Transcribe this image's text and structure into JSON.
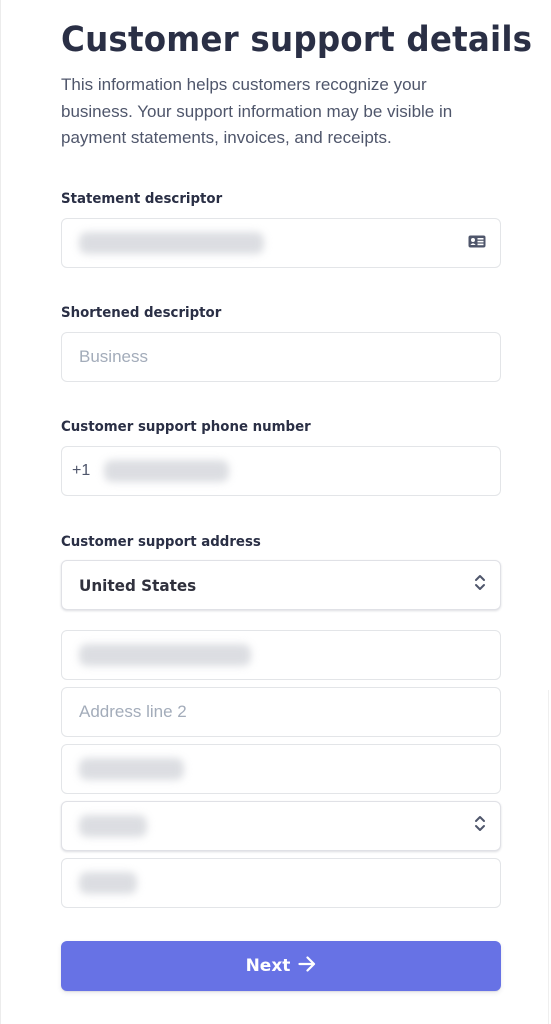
{
  "header": {
    "title": "Customer support details",
    "description": "This information helps customers recognize your business. Your support information may be visible in payment statements, invoices, and receipts."
  },
  "fields": {
    "statement_descriptor": {
      "label": "Statement descriptor",
      "value": "[redacted]",
      "icon": "id-card-icon"
    },
    "shortened_descriptor": {
      "label": "Shortened descriptor",
      "placeholder": "Business"
    },
    "phone": {
      "label": "Customer support phone number",
      "prefix": "+1",
      "value": "[redacted]"
    },
    "address": {
      "label": "Customer support address",
      "country": "United States",
      "line1": "[redacted]",
      "line2_placeholder": "Address line 2",
      "city": "[redacted]",
      "state": "[redacted]",
      "zip": "[redacted]"
    }
  },
  "actions": {
    "next_label": "Next",
    "next_icon": "arrow-right-icon"
  },
  "colors": {
    "primary": "#6772e5",
    "heading": "#2a2f45",
    "body_text": "#4f566b",
    "placeholder": "#a3acba",
    "border": "#e3e5e8"
  }
}
